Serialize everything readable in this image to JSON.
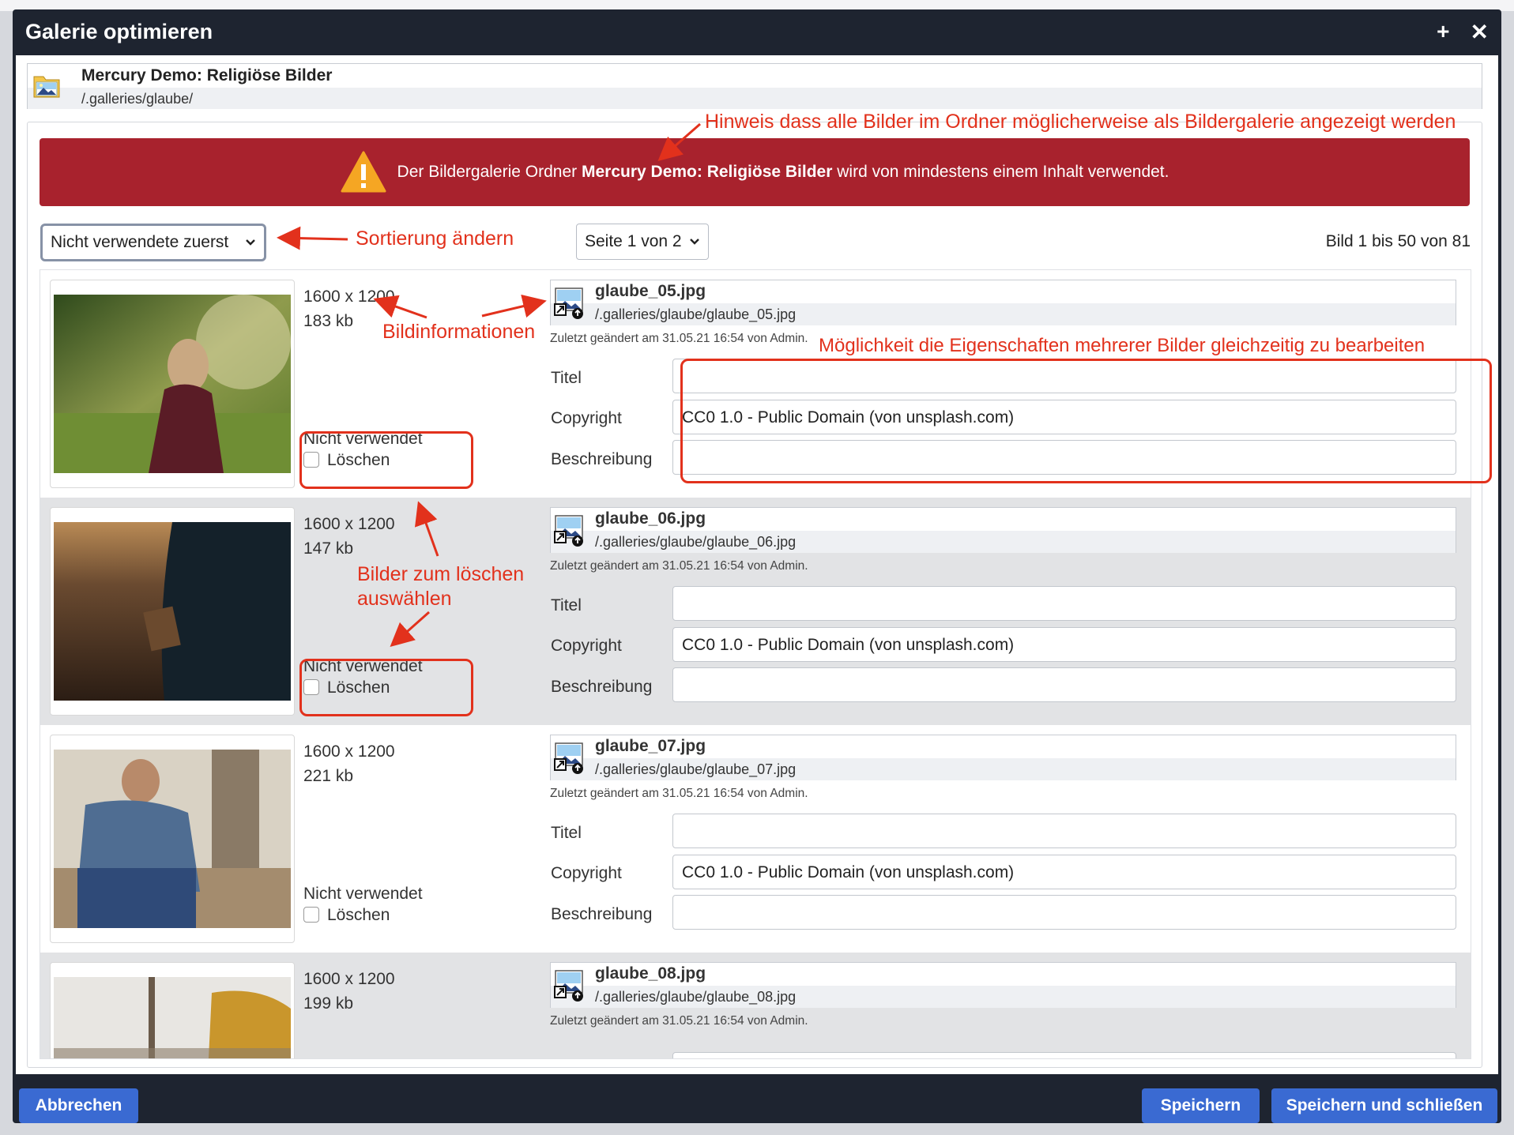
{
  "dialog": {
    "title": "Galerie optimieren",
    "btn_add": "+",
    "btn_close": "✕"
  },
  "folder": {
    "name": "Mercury Demo: Religiöse Bilder",
    "path": "/.galleries/glaube/"
  },
  "alert": {
    "text_before": "Der Bildergalerie Ordner",
    "folder_name": "Mercury Demo: Religiöse Bilder",
    "text_after": "wird von mindestens einem Inhalt verwendet."
  },
  "controls": {
    "sort_value": "Nicht verwendete zuerst",
    "page_value": "Seite 1 von 2",
    "range_info": "Bild 1 bis 50 von 81"
  },
  "annotations": {
    "hint": "Hinweis dass alle Bilder im Ordner möglicherweise als Bildergalerie angezeigt werden",
    "sort": "Sortierung ändern",
    "info": "Bildinformationen",
    "multi_edit": "Möglichkeit die Eigenschaften mehrerer Bilder gleichzeitig zu bearbeiten",
    "delete_line1": "Bilder zum löschen",
    "delete_line2": "auswählen"
  },
  "labels": {
    "title": "Titel",
    "copyright": "Copyright",
    "description": "Beschreibung",
    "unused": "Nicht verwendet",
    "delete": "Löschen"
  },
  "images": [
    {
      "name": "glaube_05.jpg",
      "path": "/.galleries/glaube/glaube_05.jpg",
      "dims": "1600 x 1200",
      "size": "183 kb",
      "modified": "Zuletzt geändert am 31.05.21 16:54 von Admin.",
      "title": "",
      "copyright": "CC0 1.0 - Public Domain (von unsplash.com)",
      "description": ""
    },
    {
      "name": "glaube_06.jpg",
      "path": "/.galleries/glaube/glaube_06.jpg",
      "dims": "1600 x 1200",
      "size": "147 kb",
      "modified": "Zuletzt geändert am 31.05.21 16:54 von Admin.",
      "title": "",
      "copyright": "CC0 1.0 - Public Domain (von unsplash.com)",
      "description": ""
    },
    {
      "name": "glaube_07.jpg",
      "path": "/.galleries/glaube/glaube_07.jpg",
      "dims": "1600 x 1200",
      "size": "221 kb",
      "modified": "Zuletzt geändert am 31.05.21 16:54 von Admin.",
      "title": "",
      "copyright": "CC0 1.0 - Public Domain (von unsplash.com)",
      "description": ""
    },
    {
      "name": "glaube_08.jpg",
      "path": "/.galleries/glaube/glaube_08.jpg",
      "dims": "1600 x 1200",
      "size": "199 kb",
      "modified": "Zuletzt geändert am 31.05.21 16:54 von Admin."
    }
  ],
  "footer": {
    "cancel": "Abbrechen",
    "save": "Speichern",
    "save_close": "Speichern und schließen"
  },
  "colors": {
    "annotation": "#e2311c",
    "alert": "#a8222d",
    "button": "#3a6ad2",
    "dialog_frame": "#1e2430"
  }
}
